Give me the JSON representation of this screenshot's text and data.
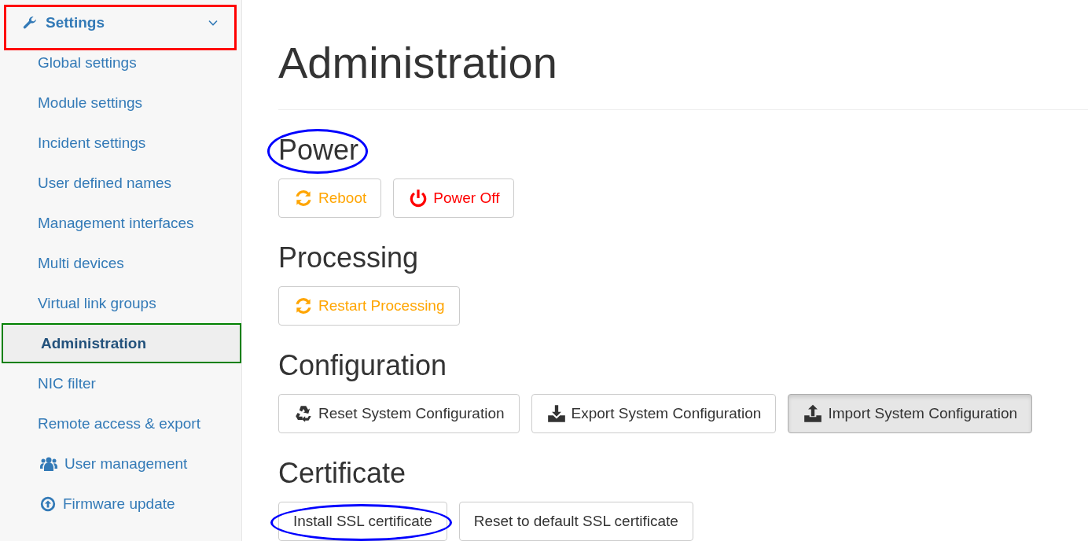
{
  "sidebar": {
    "header": {
      "label": "Settings",
      "expanded": true,
      "outlined": true
    },
    "items": [
      {
        "label": "Global settings",
        "kind": "plain",
        "selected": false
      },
      {
        "label": "Module settings",
        "kind": "plain",
        "selected": false
      },
      {
        "label": "Incident settings",
        "kind": "plain",
        "selected": false
      },
      {
        "label": "User defined names",
        "kind": "plain",
        "selected": false
      },
      {
        "label": "Management interfaces",
        "kind": "plain",
        "selected": false
      },
      {
        "label": "Multi devices",
        "kind": "plain",
        "selected": false
      },
      {
        "label": "Virtual link groups",
        "kind": "plain",
        "selected": false
      },
      {
        "label": "Administration",
        "kind": "plain",
        "selected": true,
        "outlined": true
      },
      {
        "label": "NIC filter",
        "kind": "plain",
        "selected": false
      },
      {
        "label": "Remote access & export",
        "kind": "plain",
        "selected": false
      },
      {
        "label": "User management",
        "kind": "users",
        "selected": false
      },
      {
        "label": "Firmware update",
        "kind": "upload",
        "selected": false
      }
    ]
  },
  "page": {
    "title": "Administration",
    "sections": [
      {
        "heading": "Power",
        "circled": true,
        "buttons": [
          {
            "label": "Reboot",
            "kind": "reboot",
            "selected": false,
            "circled": false
          },
          {
            "label": "Power Off",
            "kind": "power",
            "selected": false,
            "circled": false
          }
        ]
      },
      {
        "heading": "Processing",
        "circled": false,
        "buttons": [
          {
            "label": "Restart Processing",
            "kind": "reboot",
            "selected": false,
            "circled": false
          }
        ]
      },
      {
        "heading": "Configuration",
        "circled": false,
        "buttons": [
          {
            "label": "Reset System Configuration",
            "kind": "recycle",
            "selected": false,
            "circled": false
          },
          {
            "label": "Export System Configuration",
            "kind": "download",
            "selected": false,
            "circled": false
          },
          {
            "label": "Import System Configuration",
            "kind": "upload",
            "selected": true,
            "circled": false
          }
        ]
      },
      {
        "heading": "Certificate",
        "circled": false,
        "buttons": [
          {
            "label": "Install SSL certificate",
            "kind": "plain",
            "selected": false,
            "circled": true
          },
          {
            "label": "Reset to default SSL certificate",
            "kind": "plain",
            "selected": false,
            "circled": false
          }
        ]
      }
    ]
  }
}
